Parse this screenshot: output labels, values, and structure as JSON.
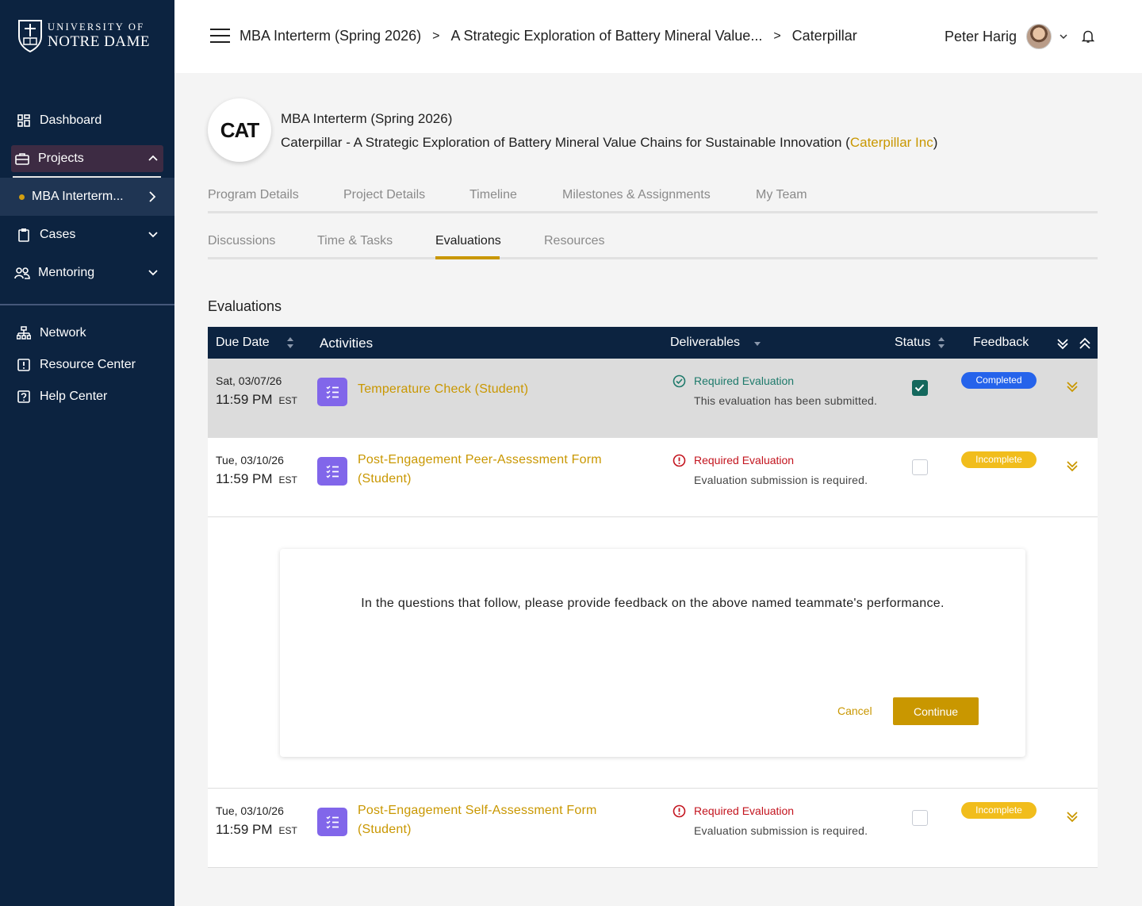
{
  "sidebar": {
    "logo": {
      "line1": "UNIVERSITY OF",
      "line2": "NOTRE DAME"
    },
    "items": [
      {
        "label": "Dashboard"
      },
      {
        "label": "Projects"
      },
      {
        "label": "MBA Interterm..."
      },
      {
        "label": "Cases"
      },
      {
        "label": "Mentoring"
      },
      {
        "label": "Network"
      },
      {
        "label": "Resource Center"
      },
      {
        "label": "Help Center"
      }
    ]
  },
  "header": {
    "breadcrumbs": [
      "MBA Interterm (Spring 2026)",
      "A Strategic Exploration of Battery Mineral Value...",
      "Caterpillar"
    ],
    "user_name": "Peter Harig"
  },
  "project": {
    "logo_text": "CAT",
    "program": "MBA Interterm (Spring 2026)",
    "title": "Caterpillar - A Strategic Exploration of Battery Mineral Value Chains for Sustainable Innovation (",
    "client": "Caterpillar Inc",
    "title_end": ")"
  },
  "tabs_row1": [
    "Program Details",
    "Project Details",
    "Timeline",
    "Milestones & Assignments",
    "My Team"
  ],
  "tabs_row2": [
    "Discussions",
    "Time & Tasks",
    "Evaluations",
    "Resources"
  ],
  "active_tab": "Evaluations",
  "section_title": "Evaluations",
  "table": {
    "headers": {
      "due_date": "Due Date",
      "activities": "Activities",
      "deliverables": "Deliverables",
      "status": "Status",
      "feedback": "Feedback"
    },
    "rows": [
      {
        "date": "Sat, 03/07/26",
        "time": "11:59 PM",
        "tz": "EST",
        "activity": "Temperature Check (Student)",
        "deliverable_title": "Required Evaluation",
        "deliverable_sub": "This evaluation has been submitted.",
        "checked": true,
        "feedback": "Completed"
      },
      {
        "date": "Tue, 03/10/26",
        "time": "11:59 PM",
        "tz": "EST",
        "activity": "Post-Engagement Peer-Assessment Form (Student)",
        "deliverable_title": "Required Evaluation",
        "deliverable_sub": "Evaluation submission is required.",
        "checked": false,
        "feedback": "Incomplete"
      },
      {
        "date": "Tue, 03/10/26",
        "time": "11:59 PM",
        "tz": "EST",
        "activity": "Post-Engagement Self-Assessment Form (Student)",
        "deliverable_title": "Required Evaluation",
        "deliverable_sub": "Evaluation submission is required.",
        "checked": false,
        "feedback": "Incomplete"
      }
    ]
  },
  "expanded_card": {
    "message": "In the questions that follow, please provide feedback on the above named teammate's performance.",
    "cancel": "Cancel",
    "continue": "Continue"
  },
  "colors": {
    "navy": "#0c2340",
    "gold": "#c99700",
    "activity_purple": "#8166ea",
    "badge_completed": "#2563eb",
    "badge_incomplete": "#f1bd1c",
    "success_green": "#1e7a6b",
    "error_red": "#c3141e"
  }
}
